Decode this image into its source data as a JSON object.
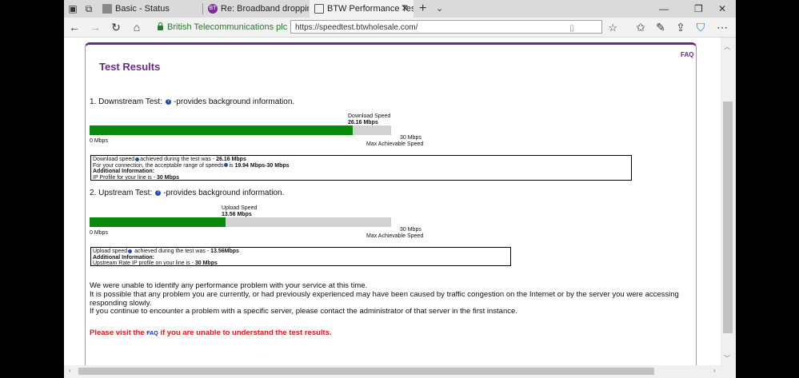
{
  "browser": {
    "tabs": [
      {
        "title": "Basic - Status",
        "favicon": "document-icon"
      },
      {
        "title": "Re: Broadband dropping ou",
        "favicon": "bt-icon"
      },
      {
        "title": "BTW Performance Test",
        "favicon": "page-icon"
      }
    ],
    "close_glyph": "✕",
    "new_tab_glyph": "+",
    "cert_name": "British Telecommunications plc [GB]",
    "url": "https://speedtest.btwholesale.com/"
  },
  "page": {
    "faq_link": "FAQ",
    "title": "Test Results",
    "downstream": {
      "heading": "1. Downstream Test:",
      "info_text": "-provides background information.",
      "speed_label": "Download Speed",
      "speed_value": "26.16 Mbps",
      "fraction": 0.872,
      "min_label": "0 Mbps",
      "max_value": "30 Mbps",
      "max_label": "Max Achievable Speed",
      "box": {
        "line1_a": "Download speed",
        "line1_b": "achieved during the test was - ",
        "line1_val": "26.16 Mbps",
        "line2_a": "For your connection, the acceptable range of speeds",
        "line2_b": "is ",
        "line2_val": "19.94 Mbps-30 Mbps",
        "line3": "Additional Information:",
        "line4_a": "IP Profile for your line is - ",
        "line4_val": "30 Mbps"
      }
    },
    "upstream": {
      "heading": "2. Upstream Test:",
      "info_text": "-provides background information.",
      "speed_label": "Upload Speed",
      "speed_value": "13.56 Mbps",
      "fraction": 0.452,
      "min_label": "0 Mbps",
      "max_value": "30 Mbps",
      "max_label": "Max Achievable Speed",
      "box": {
        "line1_a": "Upload speed",
        "line1_b": " achieved during the test was - ",
        "line1_val": "13.56Mbps",
        "line2": "Additional Information:",
        "line3_a": "Upstream Rate IP profile on your line is - ",
        "line3_val": "30 Mbps"
      }
    },
    "message_1": "We were unable to identify any performance problem with your service at this time.",
    "message_2": "It is possible that any problem you are currently, or had previously experienced may have been caused by traffic congestion on the Internet or by the server you were accessing responding slowly.",
    "message_3": "If you continue to encounter a problem with a specific server, please contact the administrator of that server in the first instance.",
    "visit_a": "Please visit the ",
    "visit_faq": "FAQ",
    "visit_b": " if you are unable to understand the test results."
  },
  "colors": {
    "brand_purple": "#6b2a8a",
    "bar_green": "#0a8a0a",
    "bar_track": "#d2d2d2",
    "alert_red": "#d52020"
  }
}
